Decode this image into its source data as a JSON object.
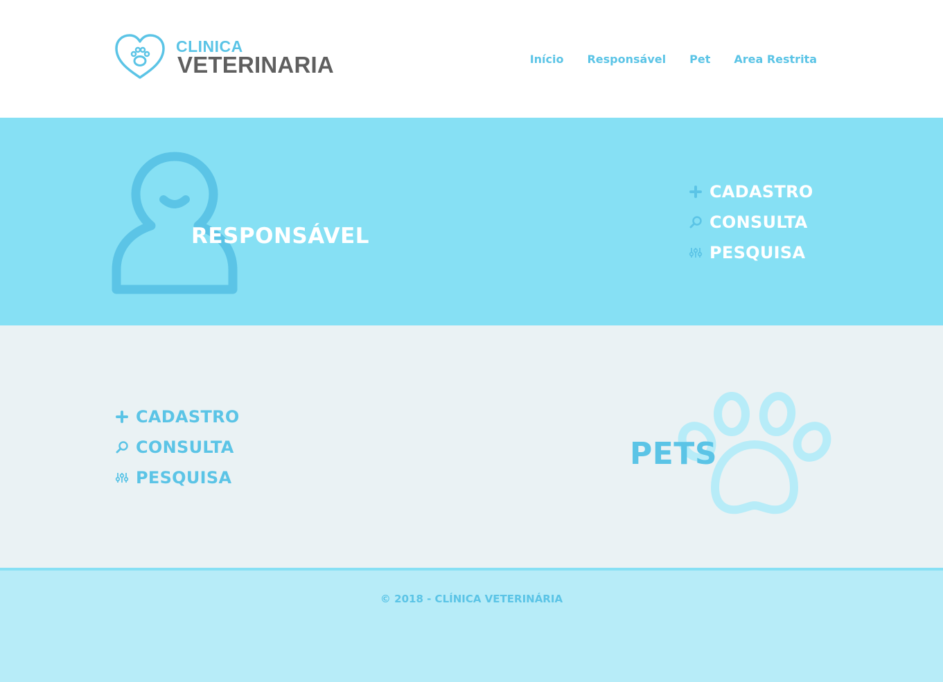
{
  "header": {
    "logo_top": "CLINICA",
    "logo_bottom": "VETERINARIA",
    "nav": [
      {
        "label": "Início"
      },
      {
        "label": "Responsável"
      },
      {
        "label": "Pet"
      },
      {
        "label": "Area Restrita"
      }
    ]
  },
  "responsavel": {
    "title": "RESPONSÁVEL",
    "menu": [
      {
        "label": "CADASTRO",
        "icon": "plus-icon"
      },
      {
        "label": "CONSULTA",
        "icon": "search-icon"
      },
      {
        "label": "PESQUISA",
        "icon": "sliders-icon"
      }
    ]
  },
  "pets": {
    "title": "PETS",
    "menu": [
      {
        "label": "CADASTRO",
        "icon": "plus-icon"
      },
      {
        "label": "CONSULTA",
        "icon": "search-icon"
      },
      {
        "label": "PESQUISA",
        "icon": "sliders-icon"
      }
    ]
  },
  "footer": {
    "text": "© 2018 - CLÍNICA VETERINÁRIA"
  },
  "colors": {
    "accent": "#5bc4e6",
    "band": "#86e0f4",
    "light_bg": "#eaf2f4",
    "footer_bg": "#b7ecf8",
    "logo_dark": "#5f5f5f"
  }
}
